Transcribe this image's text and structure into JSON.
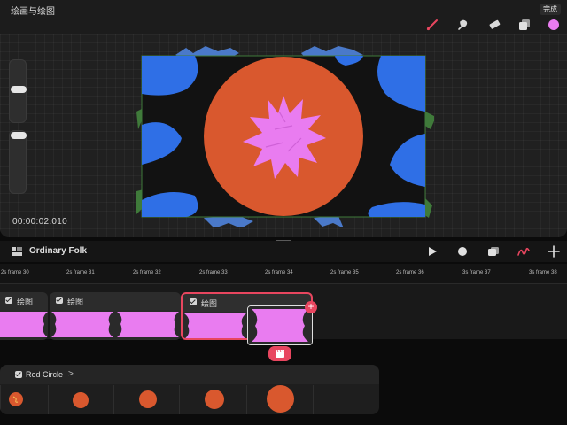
{
  "app": {
    "title": "绘画与绘图",
    "done_label": "完成"
  },
  "toolbar": {
    "tools": [
      "brush-icon",
      "smudge-icon",
      "eraser-icon",
      "layers-icon",
      "color-swatch"
    ],
    "active_color": "#e97cf0",
    "brush_color": "#e8465f"
  },
  "canvas": {
    "timecode": "00:00:02.010"
  },
  "timeline": {
    "project_name": "Ordinary Folk",
    "ruler_labels": [
      "2s frame 30",
      "2s frame 31",
      "2s frame 32",
      "2s frame 33",
      "2s frame 34",
      "2s frame 35",
      "2s frame 36",
      "3s frame 37",
      "3s frame 38"
    ],
    "clips": [
      {
        "title": "绘图"
      },
      {
        "title": "绘图"
      },
      {
        "title": "绘图"
      }
    ],
    "group": {
      "title": "Red Circle",
      "chevron": ">"
    }
  },
  "colors": {
    "accent": "#e8465f",
    "pink": "#e97cf0",
    "orange": "#d9582e",
    "blue": "#2f6fe6",
    "panel": "#1c1c1c"
  }
}
